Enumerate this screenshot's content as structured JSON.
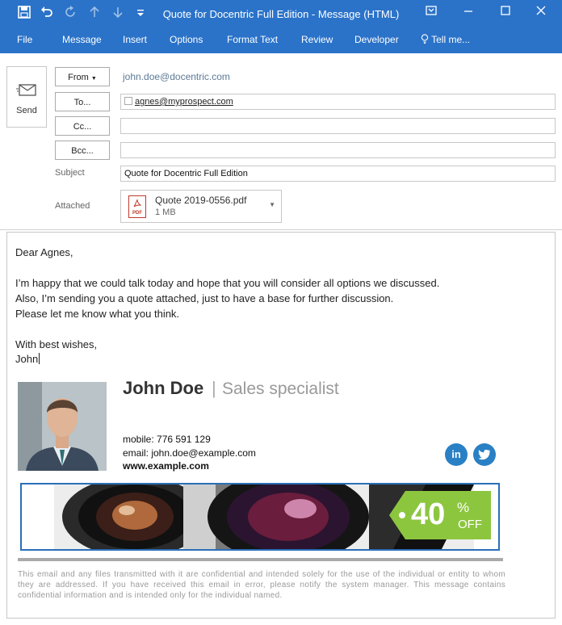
{
  "window": {
    "title": "Quote for Docentric Full Edition - Message (HTML)"
  },
  "ribbon": {
    "tabs": [
      "File",
      "Message",
      "Insert",
      "Options",
      "Format Text",
      "Review",
      "Developer",
      "Tell me..."
    ]
  },
  "header": {
    "send_label": "Send",
    "from_label": "From",
    "from_value": "john.doe@docentric.com",
    "to_label": "To...",
    "to_value": "agnes@myprospect.com",
    "cc_label": "Cc...",
    "bcc_label": "Bcc...",
    "subject_label": "Subject",
    "subject_value": "Quote for Docentric Full Edition",
    "attached_label": "Attached",
    "attachment": {
      "name": "Quote 2019-0556.pdf",
      "size": "1 MB",
      "type_tag": "PDF"
    }
  },
  "body": {
    "greeting": "Dear Agnes,",
    "line1": "I’m happy that we could talk today and hope that you will consider all options we discussed.",
    "line2": "Also, I’m sending you a quote attached, just to have a base for further discussion.",
    "line3": "Please let me know what you think.",
    "closing": "With best wishes,",
    "signoff": "John"
  },
  "signature": {
    "name": "John Doe",
    "separator": "|",
    "role": "Sales specialist",
    "mobile": "mobile: 776 591 129",
    "email": "email: john.doe@example.com",
    "website": "www.example.com",
    "social": [
      {
        "network": "linkedin-icon",
        "glyph": "in"
      },
      {
        "network": "twitter-icon",
        "glyph": "t"
      }
    ],
    "banner": {
      "discount": "40",
      "percent": "%",
      "off": "OFF"
    }
  },
  "disclaimer": "This email and any files transmitted with it are confidential and intended solely for the use of the individual or entity to whom they are addressed. If you have received this email in error, please notify the system manager. This message contains confidential information and is intended only for the individual named.",
  "colors": {
    "titlebar": "#2b73c9",
    "social": "#2a80c4",
    "banner_border": "#2a6fb8",
    "badge": "#8cc63f"
  }
}
